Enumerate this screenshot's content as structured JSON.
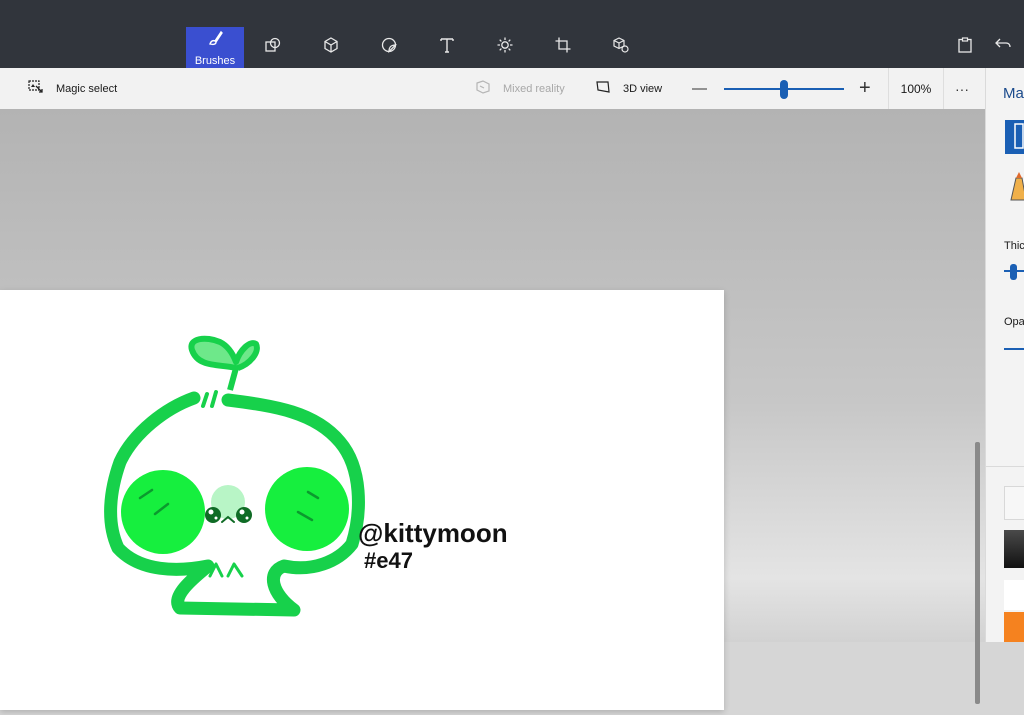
{
  "ribbon": {
    "tools": [
      {
        "name": "Brushes",
        "icon": "brush-icon",
        "active": true
      },
      {
        "name": "2D shapes",
        "icon": "2d-shapes-icon"
      },
      {
        "name": "3D shapes",
        "icon": "3d-shapes-icon"
      },
      {
        "name": "Stickers",
        "icon": "stickers-icon"
      },
      {
        "name": "Text",
        "icon": "text-icon"
      },
      {
        "name": "Effects",
        "icon": "effects-icon"
      },
      {
        "name": "Canvas",
        "icon": "canvas-icon"
      },
      {
        "name": "3D library",
        "icon": "3d-library-icon"
      }
    ],
    "active_label": "Brushes"
  },
  "toolbar": {
    "magic_select": "Magic select",
    "mixed_reality": "Mixed reality",
    "view_3d": "3D view",
    "zoom_out": "—",
    "zoom_in": "+",
    "zoom_value": "100%",
    "zoom_slider_value": 0.5,
    "more": "···"
  },
  "artwork": {
    "handle": "@kittymoon",
    "number": "#e47"
  },
  "side_panel": {
    "title": "Ma",
    "thickness_label": "Thic",
    "opacity_label": "Opa"
  },
  "colors": {
    "accent": "#3a4fd0",
    "ribbon_bg": "#31353c",
    "sprout_green": "#17d14b",
    "cheek_green": "#16ef3e",
    "slider_blue": "#1a5fb4"
  }
}
